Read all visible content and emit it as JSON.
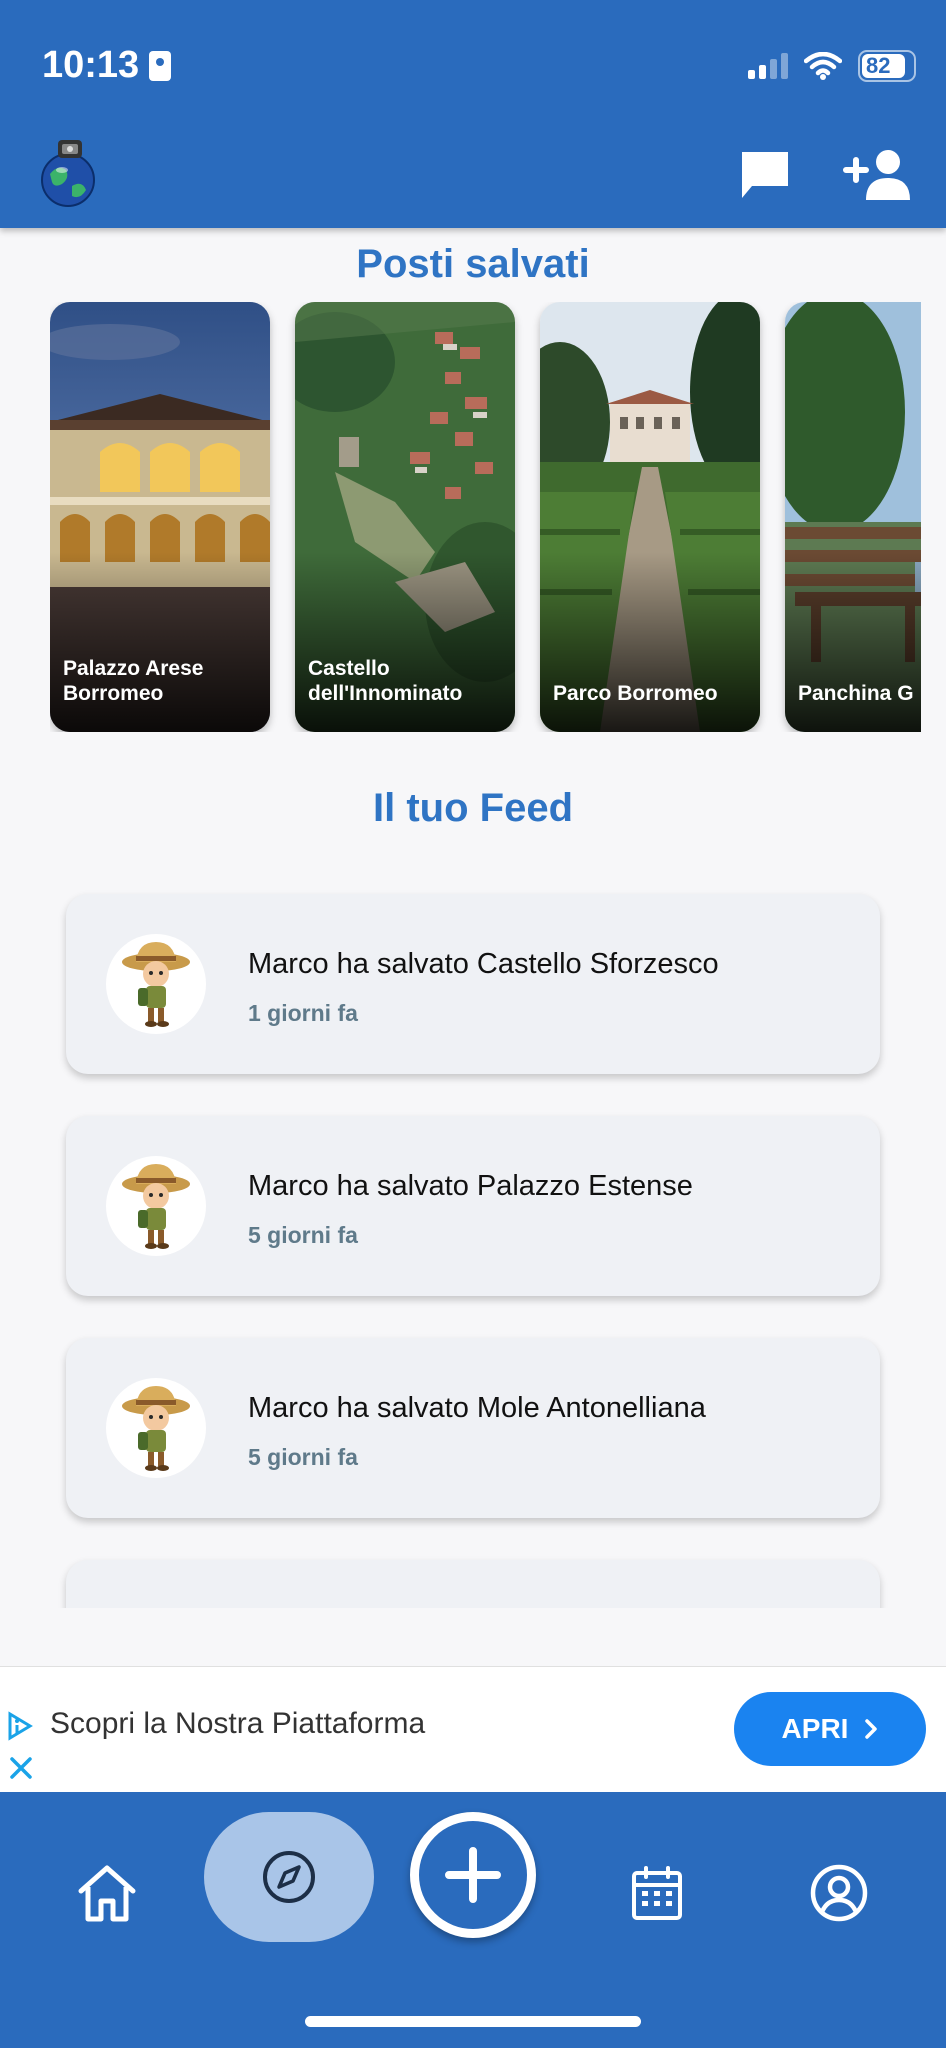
{
  "status_bar": {
    "time": "10:13",
    "battery": "82"
  },
  "saved_section": {
    "title": "Posti salvati",
    "places": [
      {
        "name": "Palazzo Arese\nBorromeo"
      },
      {
        "name": "Castello\ndell'Innominato"
      },
      {
        "name": "Parco Borromeo"
      },
      {
        "name": "Panchina G"
      }
    ]
  },
  "feed_section": {
    "title": "Il tuo Feed",
    "items": [
      {
        "text": "Marco ha salvato Castello Sforzesco",
        "time": "1 giorni fa"
      },
      {
        "text": "Marco ha salvato Palazzo Estense",
        "time": "5 giorni fa"
      },
      {
        "text": "Marco ha salvato Mole Antonelliana",
        "time": "5 giorni fa"
      }
    ]
  },
  "ad": {
    "text": "Scopri la Nostra Piattaforma",
    "button": "APRI"
  },
  "nav": {
    "items": [
      "home-icon",
      "compass-icon",
      "add-icon",
      "calendar-icon",
      "profile-icon"
    ],
    "active": "compass-icon"
  },
  "colors": {
    "primary": "#2a6bbd",
    "title": "#2f74c4",
    "ad_button": "#1a83f0"
  }
}
